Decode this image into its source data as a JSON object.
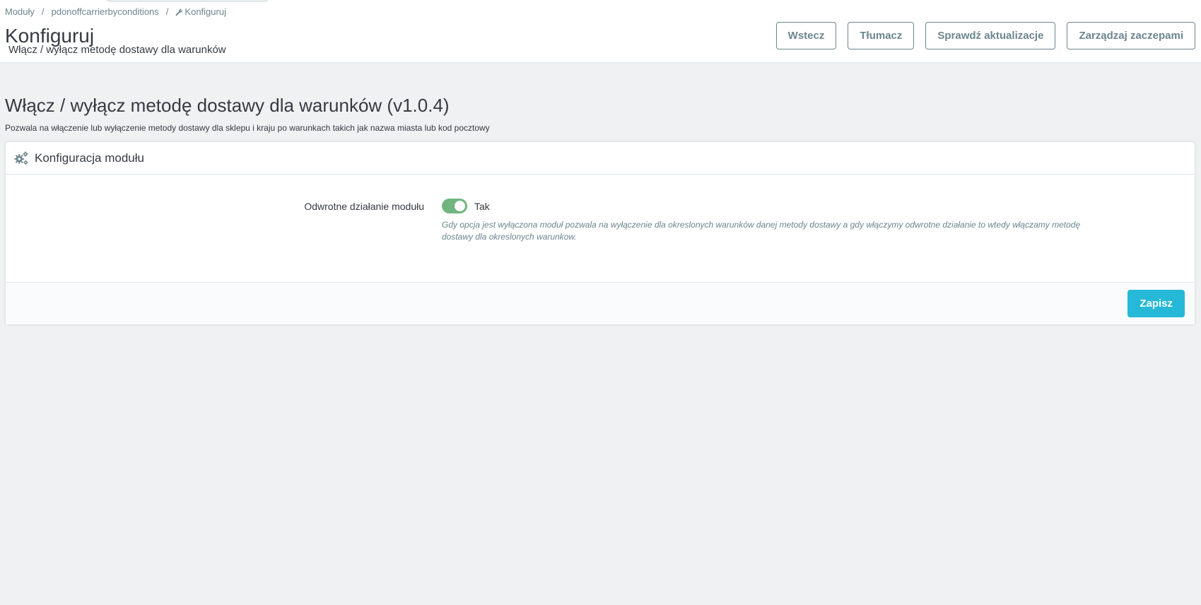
{
  "breadcrumb": {
    "items": [
      "Moduły",
      "pdonoffcarrierbyconditions",
      "Konfiguruj"
    ],
    "separator": "/"
  },
  "header": {
    "title": "Konfiguruj",
    "subtitle": "Włącz / wyłącz metodę dostawy dla warunków"
  },
  "toolbar": {
    "back_label": "Wstecz",
    "translate_label": "Tłumacz",
    "check_updates_label": "Sprawdź aktualizacje",
    "manage_hooks_label": "Zarządzaj zaczepami"
  },
  "module": {
    "title": "Włącz / wyłącz metodę dostawy dla warunków (v1.0.4)",
    "description": "Pozwala na włączenie lub wyłączenie metody dostawy dla sklepu i kraju po warunkach takich jak nazwa miasta lub kod pocztowy"
  },
  "panel": {
    "heading": "Konfiguracja modułu",
    "heading_icon": "cogs-icon",
    "field": {
      "label": "Odwrotne działanie modułu",
      "switch_state": "on",
      "switch_label": "Tak",
      "help": "Gdy opcja jest wyłączona moduł pozwala na wyłączenie dla okreslonych warunków danej metody dostawy a gdy włączymy odwrotne działanie to wtedy włączamy metodę dostawy dla okreslonych warunkow."
    },
    "save_label": "Zapisz"
  },
  "colors": {
    "primary": "#25b9d7",
    "switch_on": "#70b580",
    "secondary_text": "#6c868e",
    "background": "#eff1f2"
  }
}
